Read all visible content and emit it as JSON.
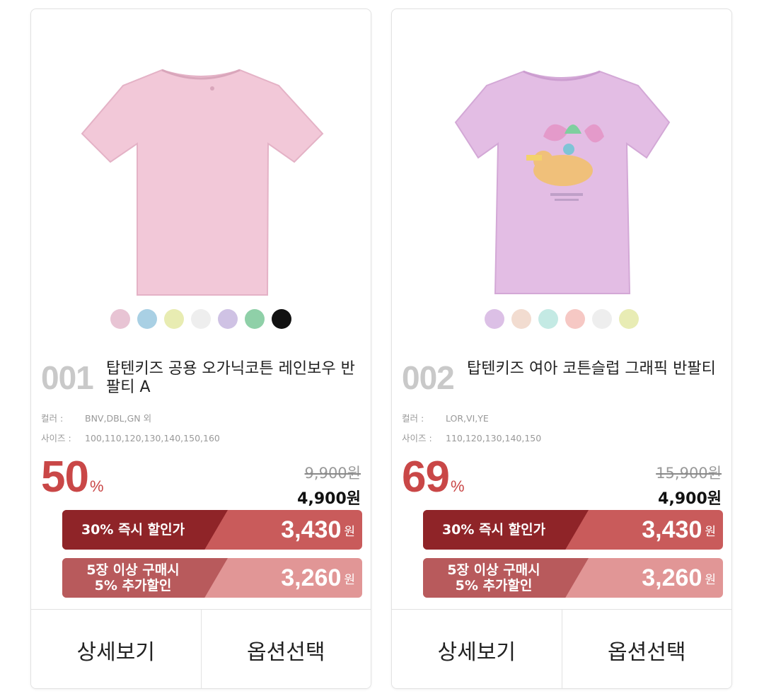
{
  "products": [
    {
      "number": "001",
      "title": "탑텐키즈 공용 오가닉코튼 레인보우 반팔티 A",
      "color_label": "컬러 :",
      "color_value": "BNV,DBL,GN 외",
      "size_label": "사이즈 :",
      "size_value": "100,110,120,130,140,150,160",
      "discount_number": "50",
      "discount_percent": "%",
      "original_price": "9,900원",
      "sale_price": "4,900원",
      "instant_label": "30% 즉시 할인가",
      "instant_amount": "3,430",
      "bulk_label_line1": "5장 이상 구매시",
      "bulk_label_line2": "5% 추가할인",
      "bulk_amount": "3,260",
      "won": "원",
      "detail_button": "상세보기",
      "option_button": "옵션선택",
      "shirt_color": "#f2c8d8",
      "swatches": [
        "#e8c4d4",
        "#a9d0e4",
        "#e8ecb2",
        "#eeeeee",
        "#cfc2e4",
        "#8fd0a8",
        "#111111"
      ]
    },
    {
      "number": "002",
      "title": "탑텐키즈 여아 코튼슬럽 그래픽 반팔티",
      "color_label": "컬러 :",
      "color_value": "LOR,VI,YE",
      "size_label": "사이즈 :",
      "size_value": "110,120,130,140,150",
      "discount_number": "69",
      "discount_percent": "%",
      "original_price": "15,900원",
      "sale_price": "4,900원",
      "instant_label": "30% 즉시 할인가",
      "instant_amount": "3,430",
      "bulk_label_line1": "5장 이상 구매시",
      "bulk_label_line2": "5% 추가할인",
      "bulk_amount": "3,260",
      "won": "원",
      "detail_button": "상세보기",
      "option_button": "옵션선택",
      "shirt_color": "#e3bde4",
      "swatches": [
        "#dcc0e6",
        "#f2dcd0",
        "#c4eae4",
        "#f6c8c4",
        "#eeeeee",
        "#e8ecb4"
      ]
    }
  ],
  "colors": {
    "discount_red": "#c94747",
    "bar_dark": "#8f2428",
    "bar_main": "#c95b5b",
    "bar_light_dark": "#b85a5c",
    "bar_light": "#e19696"
  }
}
